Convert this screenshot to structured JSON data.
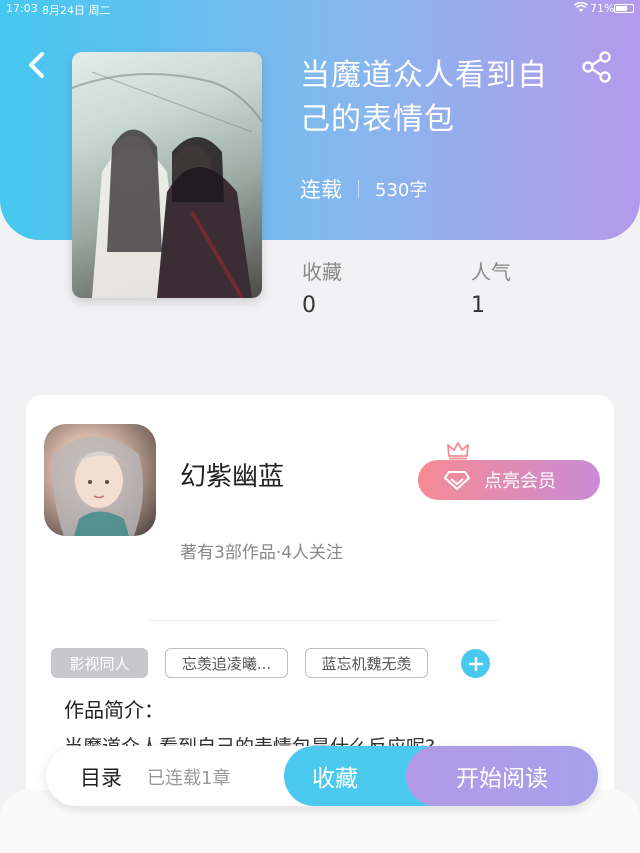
{
  "status_bar": {
    "time": "17:03",
    "date": "8月24日 周二",
    "battery": "71%",
    "battery_level": 0.71
  },
  "header": {
    "back_icon": "chevron-left-icon",
    "share_icon": "share-icon"
  },
  "book": {
    "title": "当魔道众人看到自己的表情包",
    "serial_status": "连载",
    "word_count": "530字"
  },
  "stats": {
    "favorites_label": "收藏",
    "favorites_value": "0",
    "popularity_label": "人气",
    "popularity_value": "1"
  },
  "author": {
    "name": "幻紫幽蓝",
    "meta": "著有3部作品·4人关注",
    "vip_label": "点亮会员"
  },
  "tags": [
    {
      "label": "影视同人"
    },
    {
      "label": "忘羡追凌曦..."
    },
    {
      "label": "蓝忘机魏无羡"
    }
  ],
  "intro": {
    "title": "作品简介：",
    "text": "当魔道众人看到自己的表情包是什么反应呢?"
  },
  "bottom_bar": {
    "toc_label": "目录",
    "toc_count": "已连载1章",
    "favorite_label": "收藏",
    "read_label": "开始阅读"
  },
  "colors": {
    "accent_blue": "#4cc9ef",
    "accent_purple": "#b29ae8",
    "vip_pink": "#f58b94"
  }
}
